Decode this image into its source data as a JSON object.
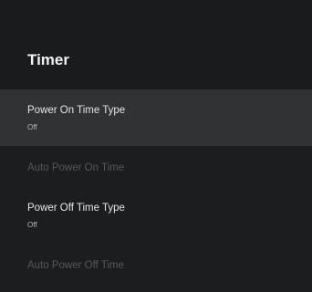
{
  "header": {
    "title": "Timer"
  },
  "items": [
    {
      "label": "Power On Time Type",
      "value": "Off",
      "enabled": true,
      "focused": true
    },
    {
      "label": "Auto Power On Time",
      "enabled": false
    },
    {
      "label": "Power Off Time Type",
      "value": "Off",
      "enabled": true
    },
    {
      "label": "Auto Power Off Time",
      "enabled": false
    }
  ],
  "colors": {
    "background": "#1c1d1f",
    "focused_row": "#303234",
    "text_primary": "#e6e6e6",
    "text_disabled": "#55575a"
  }
}
